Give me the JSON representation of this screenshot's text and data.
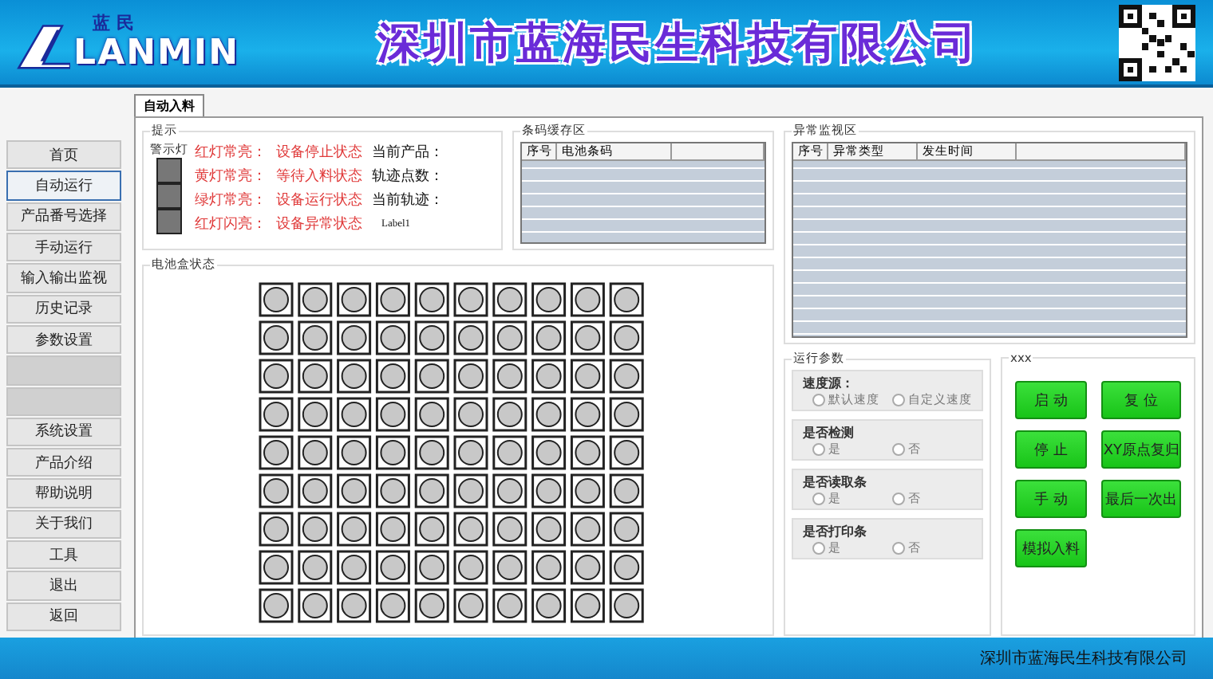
{
  "header": {
    "logo_top": "蓝 民",
    "logo_name": "LANMIN",
    "title": "深圳市蓝海民生科技有限公司"
  },
  "sidebar": {
    "items": [
      {
        "kind": "item",
        "label": "首页",
        "selected": false
      },
      {
        "kind": "item",
        "label": "自动运行",
        "selected": true
      },
      {
        "kind": "item",
        "label": "产品番号选择",
        "selected": false
      },
      {
        "kind": "item",
        "label": "手动运行",
        "selected": false
      },
      {
        "kind": "item",
        "label": "输入输出监视",
        "selected": false
      },
      {
        "kind": "item",
        "label": "历史记录",
        "selected": false
      },
      {
        "kind": "item",
        "label": "参数设置",
        "selected": false
      },
      {
        "kind": "blank"
      },
      {
        "kind": "blank"
      },
      {
        "kind": "item",
        "label": "系统设置",
        "selected": false
      },
      {
        "kind": "item",
        "label": "产品介绍",
        "selected": false
      },
      {
        "kind": "item",
        "label": "帮助说明",
        "selected": false
      },
      {
        "kind": "item",
        "label": "关于我们",
        "selected": false
      },
      {
        "kind": "item",
        "label": "工具",
        "selected": false
      },
      {
        "kind": "item",
        "label": "退出",
        "selected": false
      },
      {
        "kind": "item",
        "label": "返回",
        "selected": false
      }
    ]
  },
  "tabs": [
    {
      "label": "自动入料",
      "selected": true
    }
  ],
  "hint": {
    "title": "提示",
    "light_label": "警示灯",
    "lights": [
      {
        "on": false
      },
      {
        "on": false
      },
      {
        "on": false
      }
    ],
    "legend": [
      {
        "key": "红灯常亮：",
        "text": "设备停止状态"
      },
      {
        "key": "黄灯常亮：",
        "text": "等待入料状态"
      },
      {
        "key": "绿灯常亮：",
        "text": "设备运行状态"
      },
      {
        "key": "红灯闪亮：",
        "text": "设备异常状态"
      }
    ],
    "info": [
      "当前产品：",
      "轨迹点数：",
      "当前轨迹：",
      "Label1"
    ]
  },
  "barcode_cache": {
    "title": "条码缓存区",
    "columns": [
      "序号",
      "电池条码"
    ]
  },
  "exceptions": {
    "title": "异常监视区",
    "columns": [
      "序号",
      "异常类型",
      "发生时间"
    ]
  },
  "battery_box": {
    "title": "电池盒状态"
  },
  "run_params": {
    "title": "运行参数",
    "groups": [
      {
        "title": "速度源：",
        "options": [
          {
            "label": "默认速度",
            "selected": false
          },
          {
            "label": "自定义速度",
            "selected": false
          }
        ]
      },
      {
        "title": "是否检测",
        "options": [
          {
            "label": "是",
            "selected": false
          },
          {
            "label": "否",
            "selected": false
          }
        ]
      },
      {
        "title": "是否读取条",
        "options": [
          {
            "label": "是",
            "selected": false
          },
          {
            "label": "否",
            "selected": false
          }
        ]
      },
      {
        "title": "是否打印条",
        "options": [
          {
            "label": "是",
            "selected": false
          },
          {
            "label": "否",
            "selected": false
          }
        ]
      }
    ]
  },
  "controls": {
    "title": "xxx",
    "buttons": [
      "启 动",
      "复 位",
      "停 止",
      "XY原点复归",
      "手 动",
      "最后一次出",
      "模拟入料"
    ]
  },
  "footer": {
    "text": "深圳市蓝海民生科技有限公司"
  }
}
